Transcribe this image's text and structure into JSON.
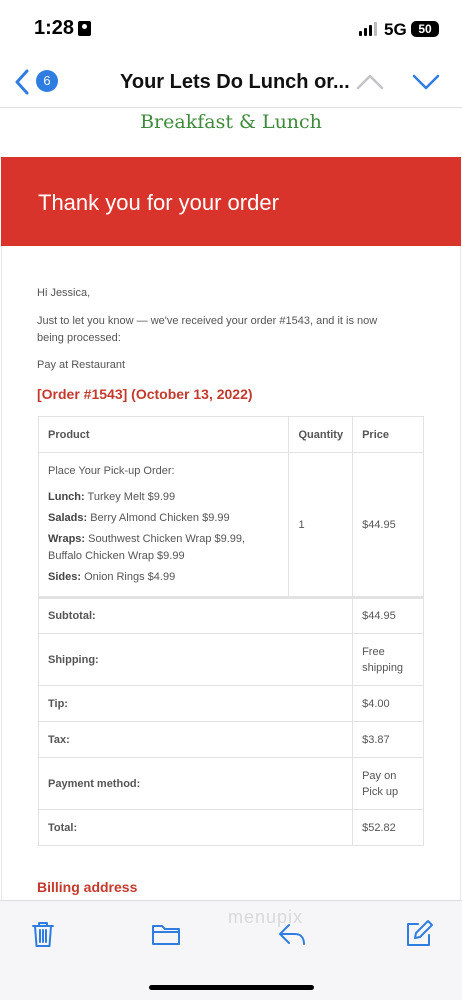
{
  "status_bar": {
    "time": "1:28",
    "network": "5G",
    "battery": "50"
  },
  "nav": {
    "badge_count": "6",
    "title": "Your Lets Do Lunch or..."
  },
  "email": {
    "brand_subtitle": "Breakfast & Lunch",
    "header_title": "Thank you for your order",
    "greeting": "Hi Jessica,",
    "intro": "Just to let you know — we've received your order #1543, and it is now being processed:",
    "payment_note": "Pay at Restaurant",
    "order_heading": "[Order #1543] (October 13, 2022)",
    "table": {
      "headers": {
        "product": "Product",
        "quantity": "Quantity",
        "price": "Price"
      },
      "item": {
        "title": "Place Your Pick-up Order:",
        "lines": [
          {
            "label": "Lunch:",
            "value": "Turkey Melt $9.99"
          },
          {
            "label": "Salads:",
            "value": "Berry Almond Chicken $9.99"
          },
          {
            "label": "Wraps:",
            "value": "Southwest Chicken Wrap $9.99, Buffalo Chicken Wrap $9.99"
          },
          {
            "label": "Sides:",
            "value": "Onion Rings $4.99"
          }
        ],
        "quantity": "1",
        "price": "$44.95"
      },
      "totals": [
        {
          "label": "Subtotal:",
          "value": "$44.95"
        },
        {
          "label": "Shipping:",
          "value": "Free shipping"
        },
        {
          "label": "Tip:",
          "value": "$4.00"
        },
        {
          "label": "Tax:",
          "value": "$3.87"
        },
        {
          "label": "Payment method:",
          "value": "Pay on Pick up"
        },
        {
          "label": "Total:",
          "value": "$52.82"
        }
      ]
    },
    "billing_heading": "Billing address"
  },
  "toolbar": {
    "watermark": "menupix"
  },
  "colors": {
    "accent_red": "#d9342b",
    "heading_red": "#c43a2e",
    "brand_green": "#3d8a3a",
    "ios_blue": "#2f7de1"
  },
  "icons": [
    "chevron-left-icon",
    "chevron-up-icon",
    "chevron-down-icon",
    "trash-icon",
    "folder-icon",
    "reply-icon",
    "compose-icon"
  ]
}
